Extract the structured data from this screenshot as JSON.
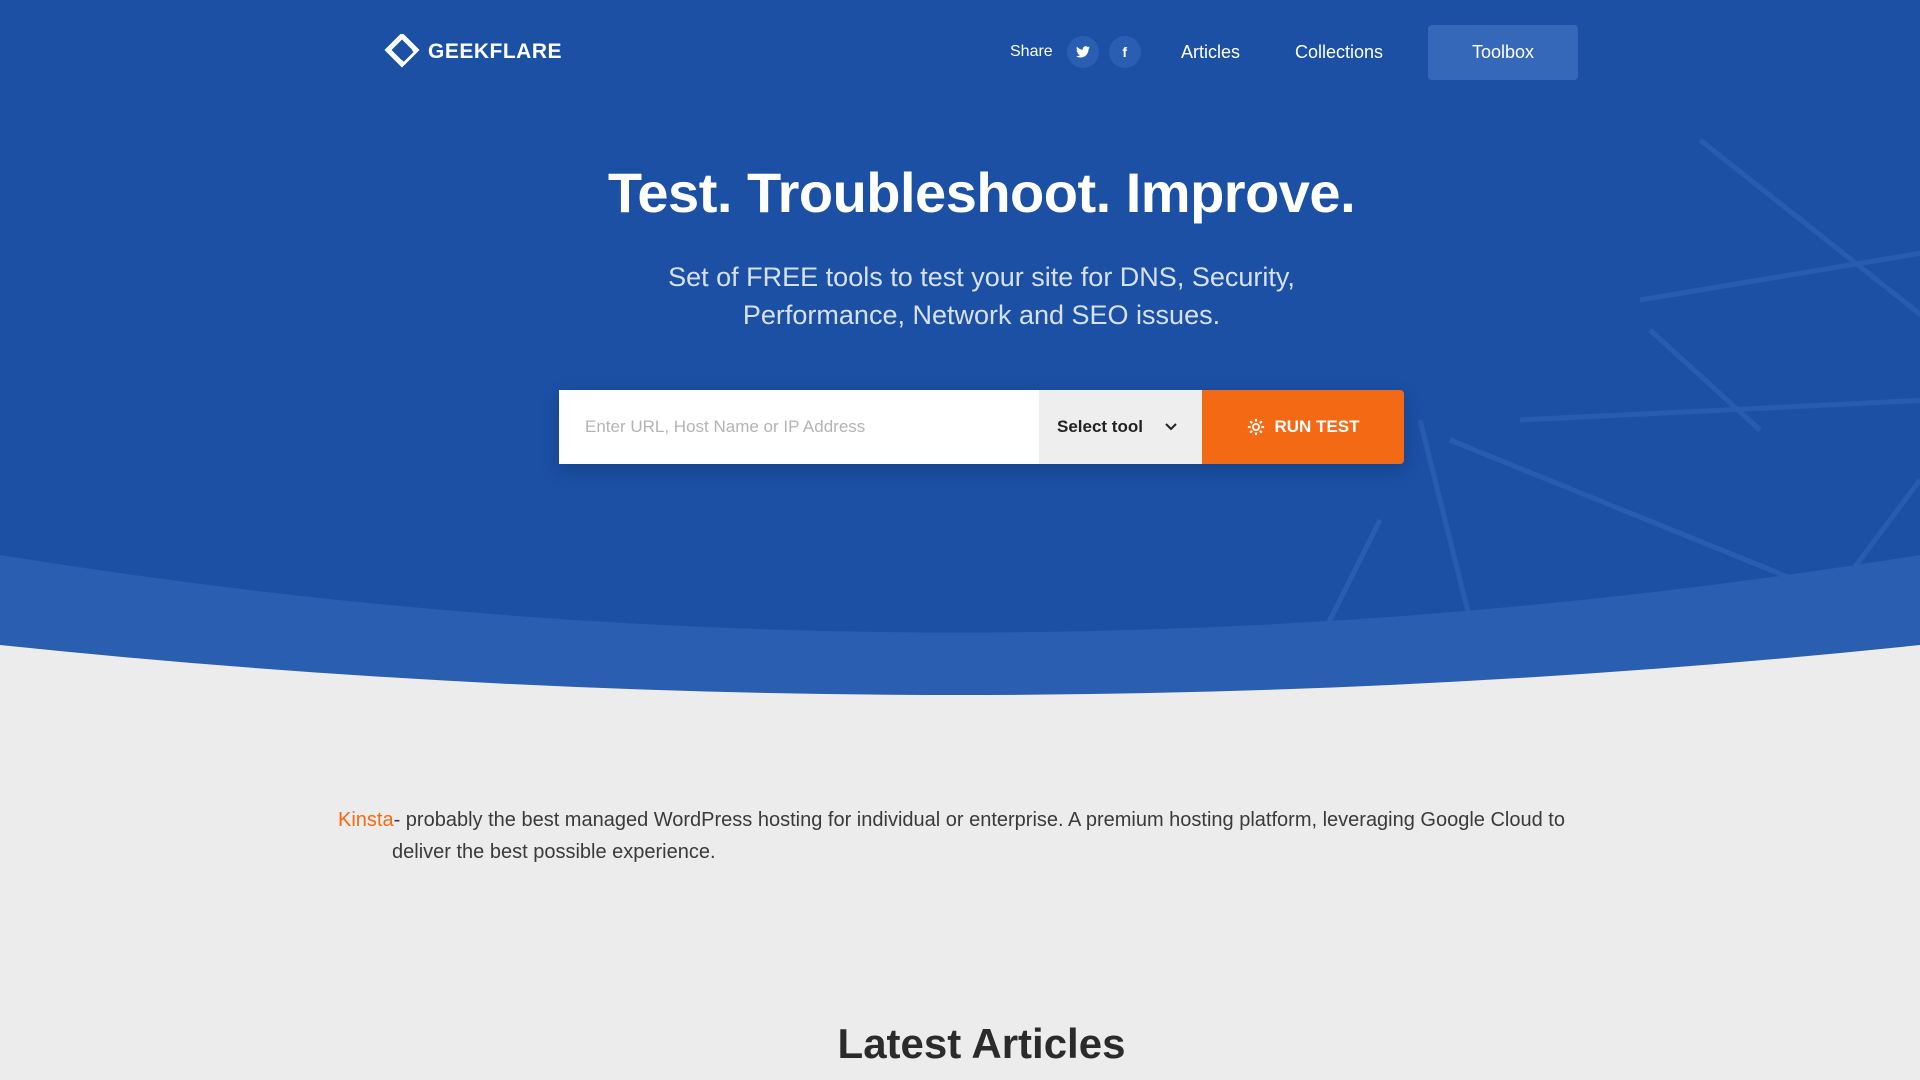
{
  "colors": {
    "hero_bg": "#1b50a5",
    "accent": "#f46a14",
    "page_bg": "#edecec"
  },
  "nav": {
    "logo_text": "GEEKFLARE",
    "share_label": "Share",
    "twitter_icon": "twitter-icon",
    "facebook_icon": "facebook-icon",
    "links": [
      "Articles",
      "Collections"
    ],
    "toolbox_label": "Toolbox"
  },
  "hero": {
    "headline": "Test. Troubleshoot. Improve.",
    "subtitle_line1": "Set of FREE tools to test your site for DNS, Security,",
    "subtitle_line2": "Performance, Network and SEO issues."
  },
  "form": {
    "url_placeholder": "Enter URL, Host Name or IP Address",
    "url_value": "",
    "select_label": "Select tool",
    "run_label": "RUN TEST"
  },
  "promo": {
    "link_text": "Kinsta",
    "text": "- probably the best managed WordPress hosting for individual or enterprise. A premium hosting platform, leveraging Google Cloud to deliver the best possible experience."
  },
  "sections": {
    "latest_title": "Latest Articles"
  }
}
